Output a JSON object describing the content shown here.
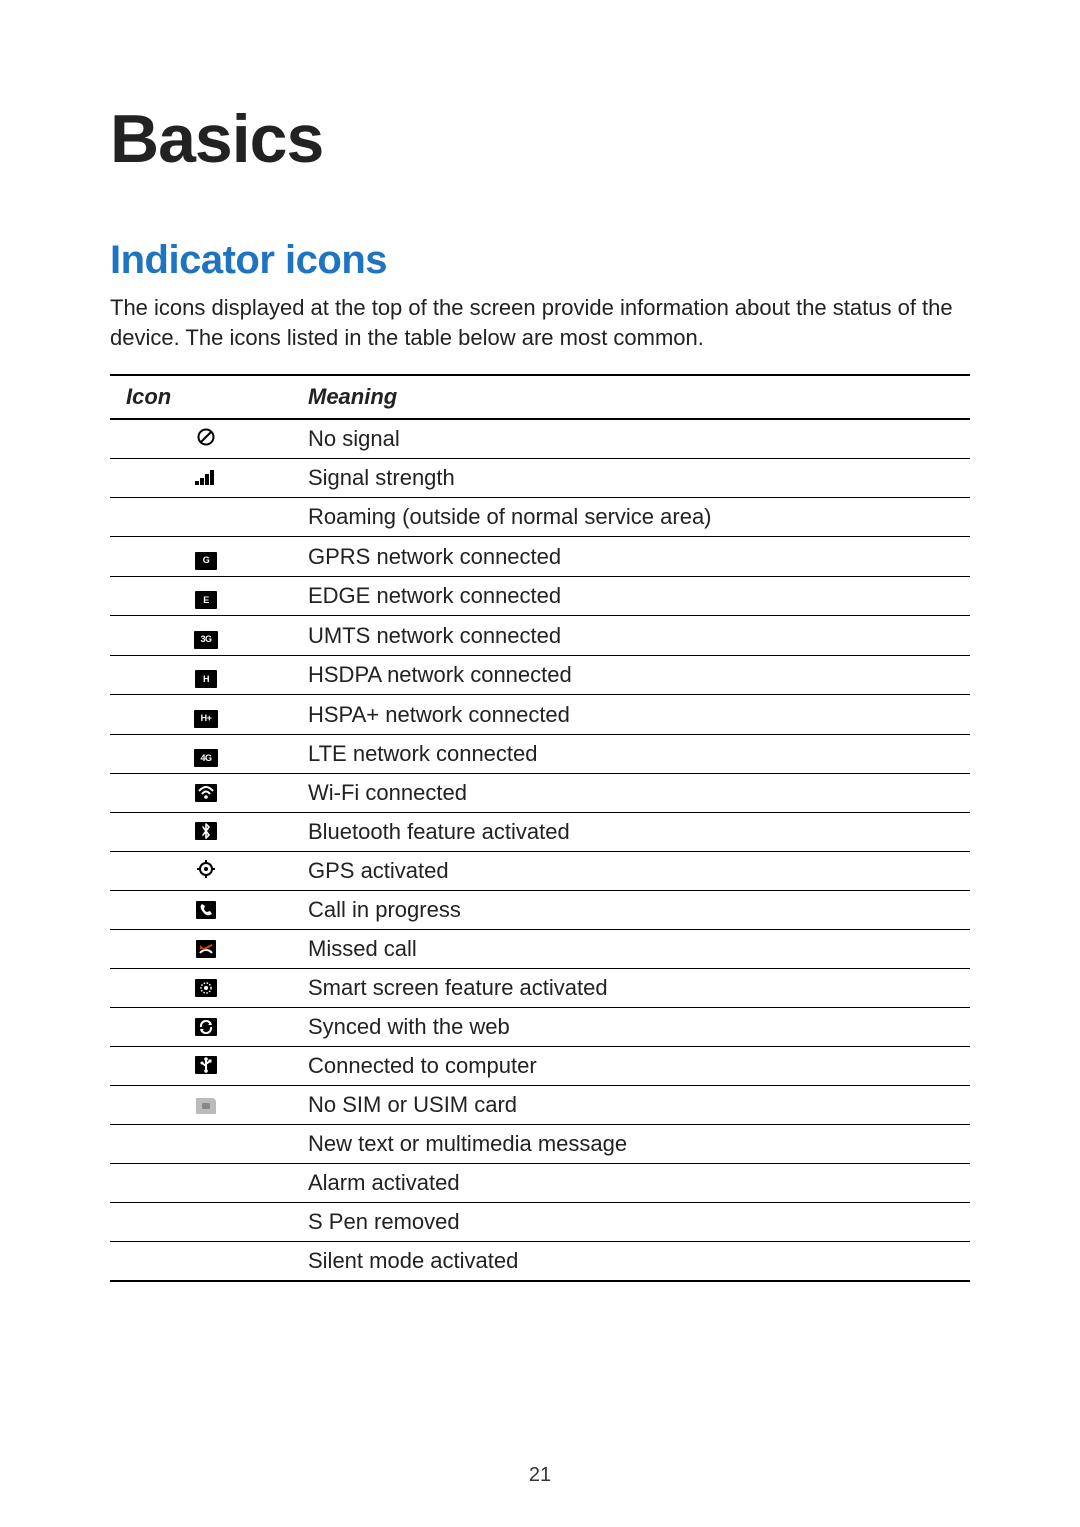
{
  "chapter_title": "Basics",
  "section_title": "Indicator icons",
  "intro_text": "The icons displayed at the top of the screen provide information about the status of the device. The icons listed in the table below are most common.",
  "table": {
    "header_icon": "Icon",
    "header_meaning": "Meaning",
    "rows": [
      {
        "icon_key": "no-signal",
        "meaning": "No signal"
      },
      {
        "icon_key": "signal-strength",
        "meaning": "Signal strength"
      },
      {
        "icon_key": "roaming",
        "meaning": "Roaming (outside of normal service area)"
      },
      {
        "icon_key": "gprs",
        "icon_text": "G",
        "meaning": "GPRS network connected"
      },
      {
        "icon_key": "edge",
        "icon_text": "E",
        "meaning": "EDGE network connected"
      },
      {
        "icon_key": "umts",
        "icon_text": "3G",
        "meaning": "UMTS network connected"
      },
      {
        "icon_key": "hsdpa",
        "icon_text": "H",
        "meaning": "HSDPA network connected"
      },
      {
        "icon_key": "hspa-plus",
        "icon_text": "H+",
        "meaning": "HSPA+ network connected"
      },
      {
        "icon_key": "lte",
        "icon_text": "4G",
        "meaning": "LTE network connected"
      },
      {
        "icon_key": "wifi",
        "meaning": "Wi-Fi connected"
      },
      {
        "icon_key": "bluetooth",
        "meaning": "Bluetooth feature activated"
      },
      {
        "icon_key": "gps",
        "meaning": "GPS activated"
      },
      {
        "icon_key": "call",
        "meaning": "Call in progress"
      },
      {
        "icon_key": "missed-call",
        "meaning": "Missed call"
      },
      {
        "icon_key": "smart-screen",
        "meaning": "Smart screen feature activated"
      },
      {
        "icon_key": "sync",
        "meaning": "Synced with the web"
      },
      {
        "icon_key": "usb",
        "meaning": "Connected to computer"
      },
      {
        "icon_key": "no-sim",
        "meaning": "No SIM or USIM card"
      },
      {
        "icon_key": "message",
        "meaning": "New text or multimedia message"
      },
      {
        "icon_key": "alarm",
        "meaning": "Alarm activated"
      },
      {
        "icon_key": "s-pen",
        "meaning": "S Pen removed"
      },
      {
        "icon_key": "silent",
        "meaning": "Silent mode activated"
      }
    ]
  },
  "page_number": "21"
}
